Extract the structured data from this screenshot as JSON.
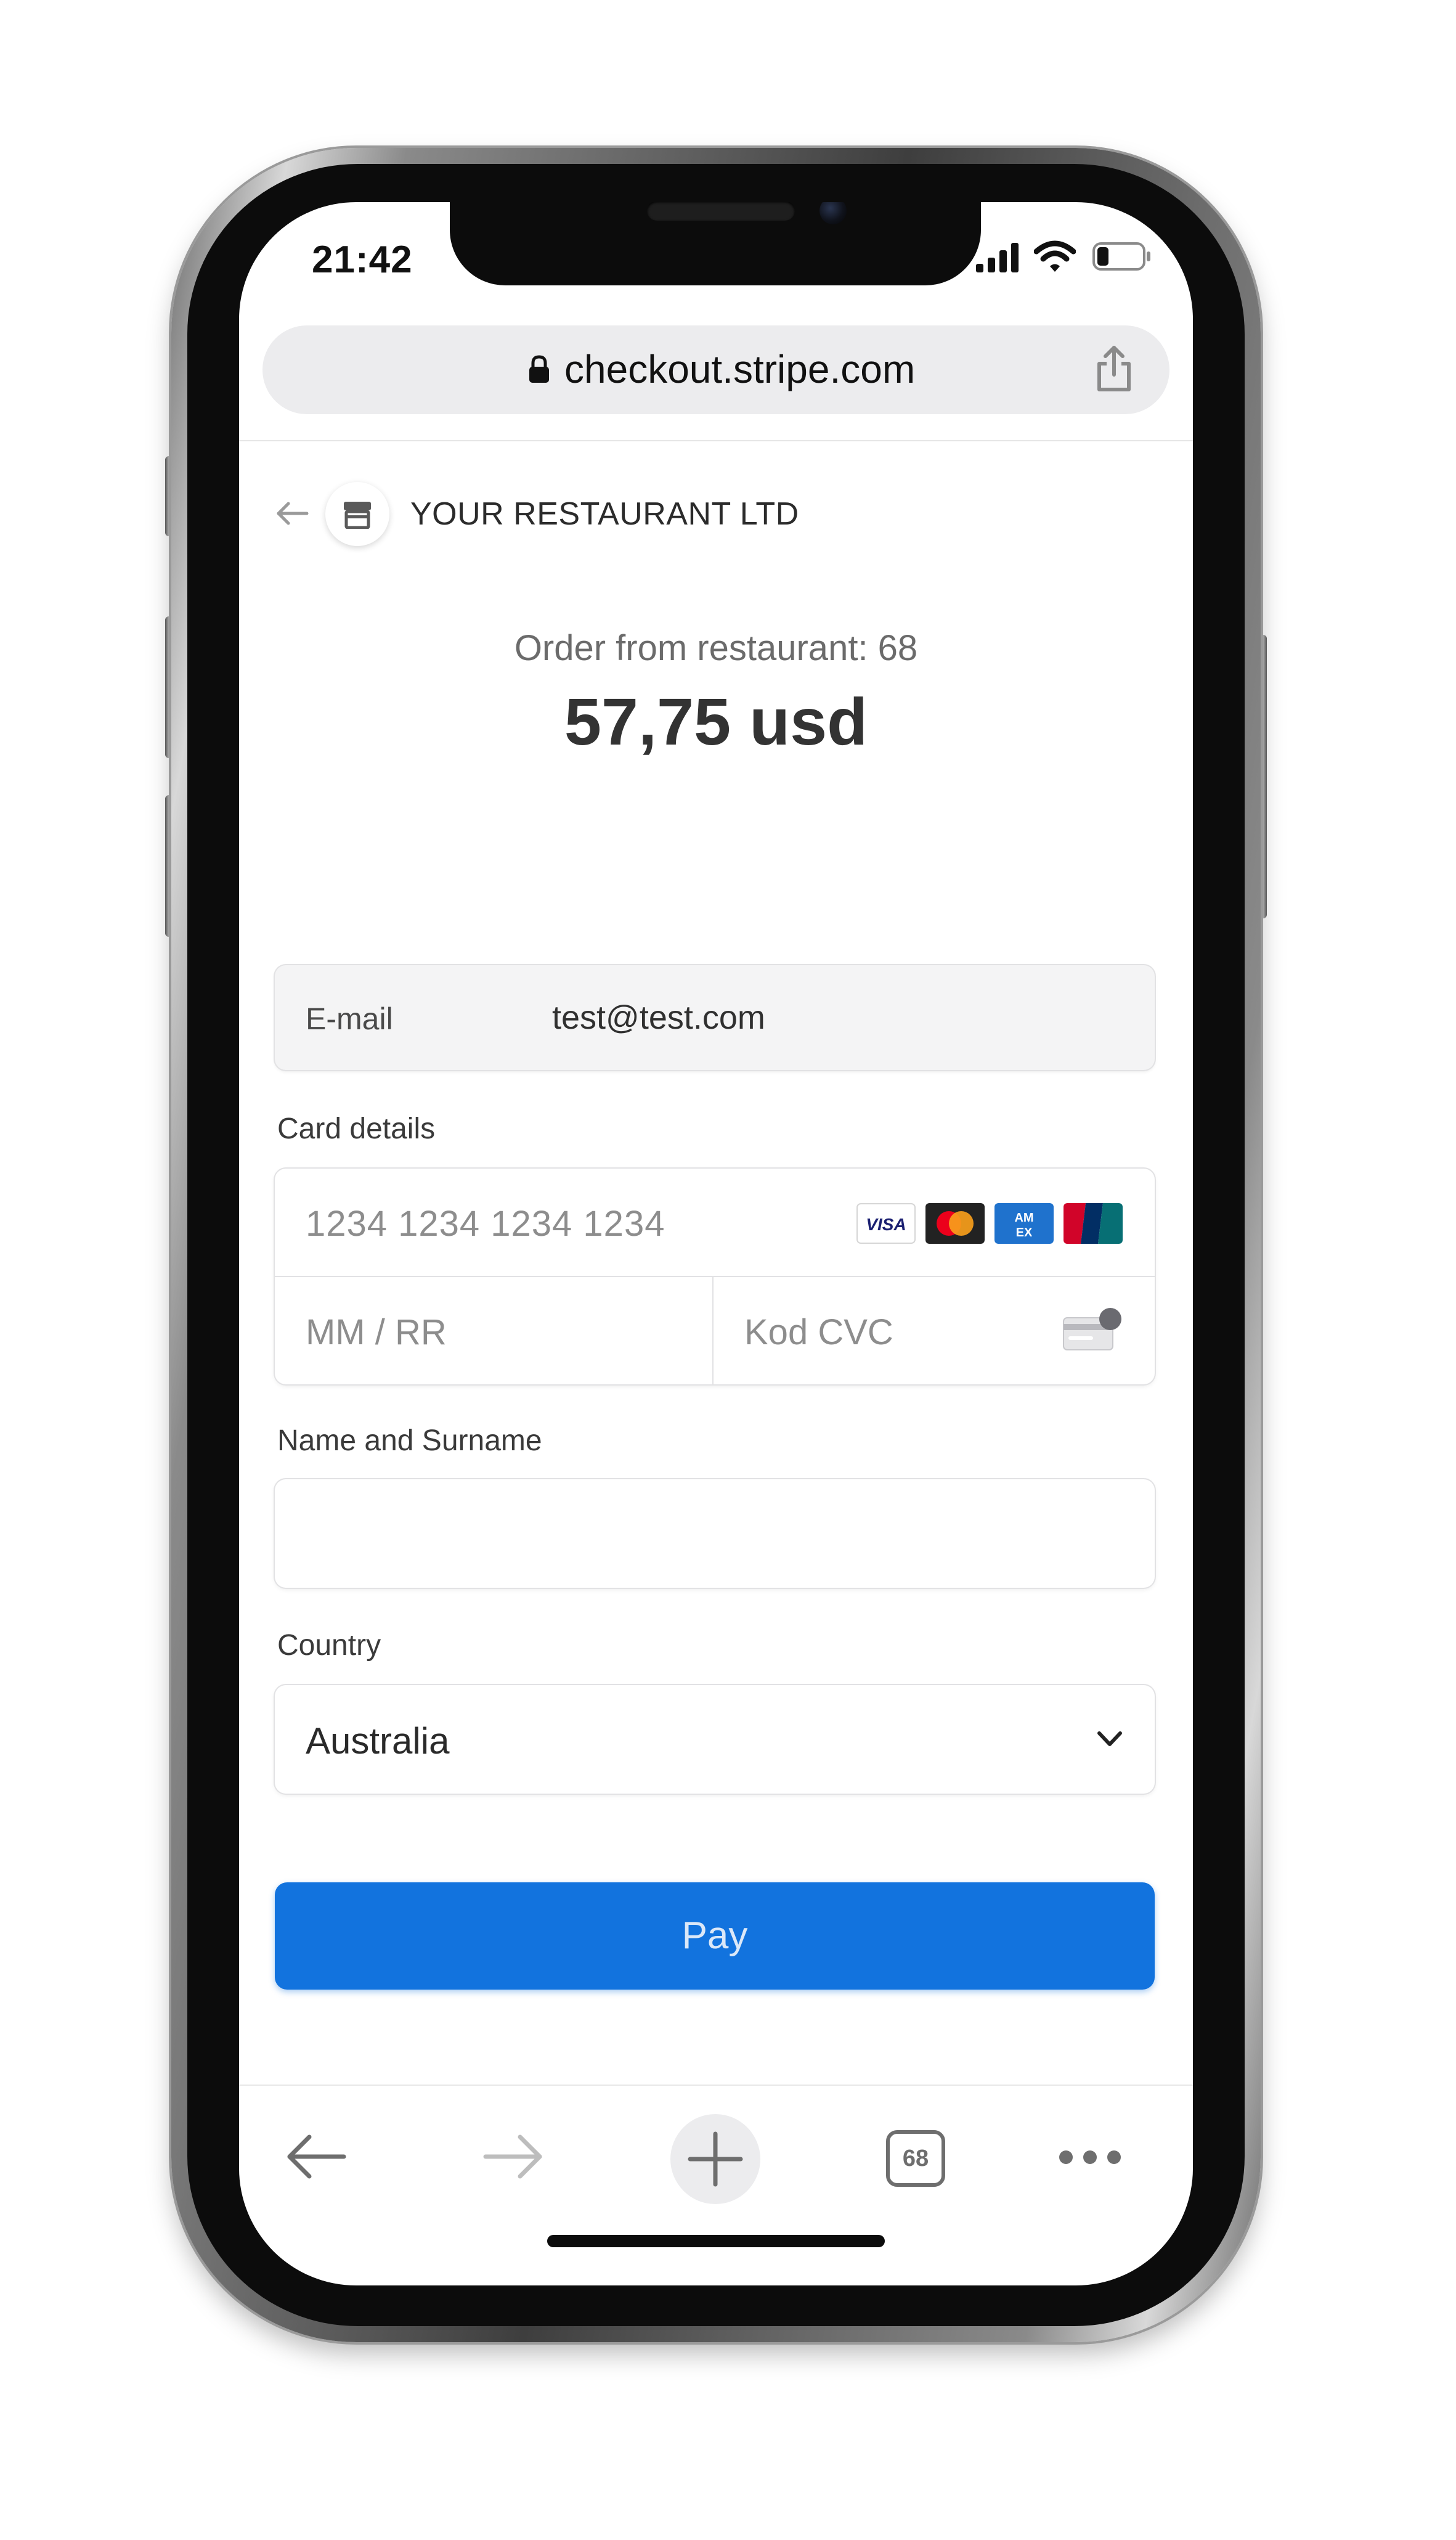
{
  "status_bar": {
    "time": "21:42"
  },
  "browser": {
    "url": "checkout.stripe.com",
    "tabs_count": "68"
  },
  "merchant": {
    "name": "YOUR RESTAURANT LTD"
  },
  "order": {
    "description": "Order from restaurant: 68",
    "amount": "57,75 usd"
  },
  "email": {
    "label": "E-mail",
    "value": "test@test.com"
  },
  "card": {
    "section_label": "Card details",
    "number_placeholder": "1234 1234 1234 1234",
    "expiry_placeholder": "MM / RR",
    "cvc_placeholder": "Kod CVC",
    "brands": [
      "visa-icon",
      "mastercard-icon",
      "amex-icon",
      "unionpay-icon"
    ]
  },
  "name": {
    "label": "Name and Surname",
    "value": ""
  },
  "country": {
    "label": "Country",
    "value": "Australia"
  },
  "pay": {
    "label": "Pay",
    "color": "#1273de"
  },
  "icons": {
    "signal": "cellular-signal-icon",
    "wifi": "wifi-icon",
    "battery": "battery-icon",
    "lock": "lock-icon",
    "share": "share-icon",
    "store": "store-icon",
    "back": "arrow-left-icon",
    "forward": "arrow-right-icon",
    "new_tab": "plus-icon",
    "more": "more-dots-icon"
  }
}
